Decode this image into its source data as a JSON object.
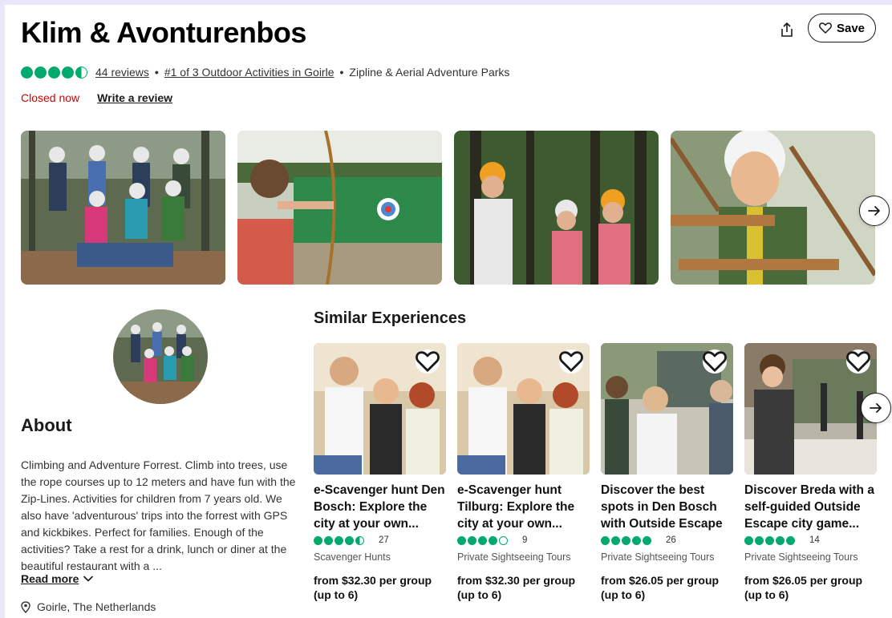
{
  "header": {
    "title": "Klim & Avonturenbos",
    "save_label": "Save"
  },
  "rating": {
    "value": 4.5,
    "reviews": "44 reviews",
    "rank": "#1 of 3 Outdoor Activities in Goirle",
    "category": "Zipline & Aerial Adventure Parks"
  },
  "status": {
    "closed": "Closed now",
    "write_review": "Write a review"
  },
  "about": {
    "title": "About",
    "text": "Climbing and Adventure Forrest. Climb into trees, use the rope courses up to 12 meters and have fun with the Zip-Lines. Activities for children from 7 years old. We also have 'adventurous' trips into the forrest with GPS and kickbikes. Perfect for families. Enough of the activities? Take a rest for a drink, lunch or diner at the beautiful restaurant with a ...",
    "read_more": "Read more",
    "location": "Goirle, The Netherlands"
  },
  "similar": {
    "title": "Similar Experiences",
    "cards": [
      {
        "title": "e-Scavenger hunt Den Bosch: Explore the city at your own...",
        "rating": 4.5,
        "reviews": "27",
        "category": "Scavenger Hunts",
        "price": "from $32.30 per group (up to 6)"
      },
      {
        "title": "e-Scavenger hunt Tilburg: Explore the city at your own...",
        "rating": 4.0,
        "reviews": "9",
        "category": "Private Sightseeing Tours",
        "price": "from $32.30 per group (up to 6)"
      },
      {
        "title": "Discover the best spots in Den Bosch with Outside Escape",
        "rating": 5.0,
        "reviews": "26",
        "category": "Private Sightseeing Tours",
        "price": "from $26.05 per group (up to 6)"
      },
      {
        "title": "Discover Breda with a self-guided Outside Escape city game...",
        "rating": 5.0,
        "reviews": "14",
        "category": "Private Sightseeing Tours",
        "price": "from $26.05 per group (up to 6)"
      }
    ]
  },
  "colors": {
    "bubble_green": "#00aa6c",
    "closed_red": "#d50000"
  },
  "icons": [
    "share-icon",
    "heart-icon",
    "arrow-right-icon",
    "chevron-down-icon",
    "location-pin-icon"
  ]
}
